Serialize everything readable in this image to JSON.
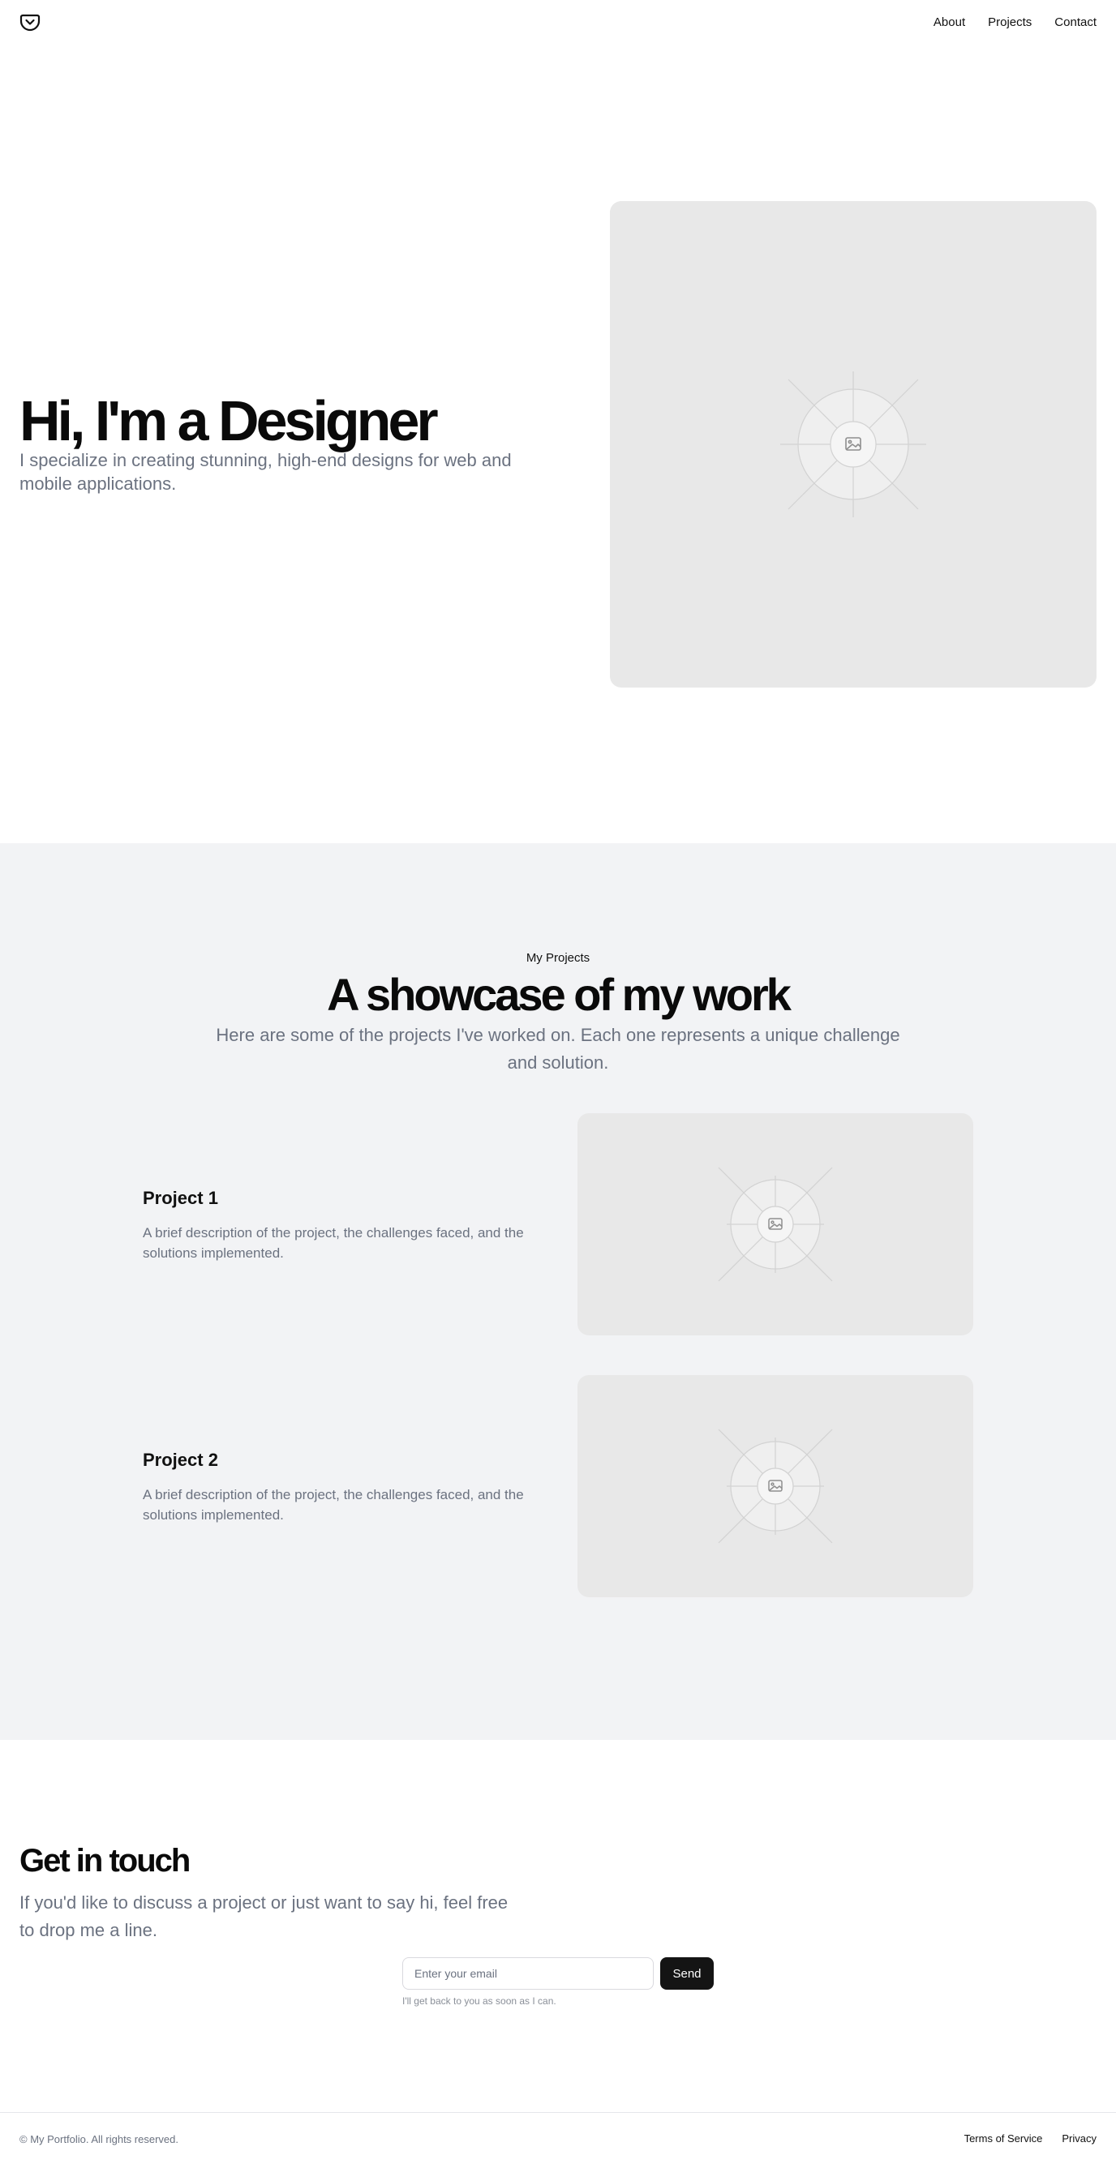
{
  "header": {
    "logo_icon": "pocket-icon",
    "nav": [
      {
        "label": "About"
      },
      {
        "label": "Projects"
      },
      {
        "label": "Contact"
      }
    ]
  },
  "hero": {
    "title": "Hi, I'm a Designer",
    "subtitle": "I specialize in creating stunning, high-end designs for web and mobile applications.",
    "image_icon": "image-placeholder-icon"
  },
  "projects": {
    "eyebrow": "My Projects",
    "title": "A showcase of my work",
    "subtitle": "Here are some of the projects I've worked on. Each one represents a unique challenge and solution.",
    "items": [
      {
        "title": "Project 1",
        "description": "A brief description of the project, the challenges faced, and the solutions implemented."
      },
      {
        "title": "Project 2",
        "description": "A brief description of the project, the challenges faced, and the solutions implemented."
      }
    ]
  },
  "contact": {
    "title": "Get in touch",
    "subtitle": "If you'd like to discuss a project or just want to say hi, feel free to drop me a line.",
    "email_placeholder": "Enter your email",
    "send_label": "Send",
    "note": "I'll get back to you as soon as I can."
  },
  "footer": {
    "copyright": "© My Portfolio. All rights reserved.",
    "links": [
      {
        "label": "Terms of Service"
      },
      {
        "label": "Privacy"
      }
    ]
  },
  "colors": {
    "projects_bg": "#f2f3f5",
    "placeholder_bg": "#e8e8e8",
    "muted_text": "#6b7280",
    "button_bg": "#141414"
  }
}
